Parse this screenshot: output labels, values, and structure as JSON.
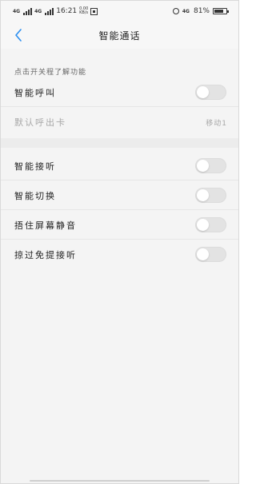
{
  "status_bar": {
    "sim1_label": "4G",
    "sim2_label": "4G",
    "time": "16:21",
    "speed_value": "0.00",
    "speed_unit": "KB/s",
    "network_label": "4G",
    "battery_text": "81%",
    "battery_level": 0.81
  },
  "header": {
    "title": "智能通话",
    "back_icon": "chevron-left-icon"
  },
  "section": {
    "caption": "点击开关程了解功能"
  },
  "group1": {
    "rows": [
      {
        "label": "智能呼叫",
        "toggle": false
      },
      {
        "label": "默认呼出卡",
        "value": "移动1"
      }
    ]
  },
  "group2": {
    "rows": [
      {
        "label": "智能接听",
        "toggle": false
      },
      {
        "label": "智能切换",
        "toggle": false
      },
      {
        "label": "捂住屏幕静音",
        "toggle": false
      },
      {
        "label": "掠过免提接听",
        "toggle": false
      }
    ]
  },
  "colors": {
    "accent": "#2a8ef0",
    "toggle_off": "#e3e3e3",
    "background": "#f4f4f4"
  }
}
